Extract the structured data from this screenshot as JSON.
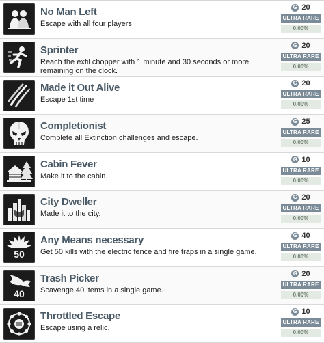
{
  "achievements": [
    {
      "title": "No Man Left",
      "description": "Escape with all four players",
      "gamerscore": "20",
      "rarity": "ULTRA RARE",
      "percent": "0.00%",
      "icon": "four-players-icon"
    },
    {
      "title": "Sprinter",
      "description": "Reach the exfil chopper with 1 minute and 30 seconds or more remaining on the clock.",
      "gamerscore": "20",
      "rarity": "ULTRA RARE",
      "percent": "0.00%",
      "icon": "running-man-icon"
    },
    {
      "title": "Made it Out Alive",
      "description": "Escape 1st time",
      "gamerscore": "20",
      "rarity": "ULTRA RARE",
      "percent": "0.00%",
      "icon": "claw-marks-icon"
    },
    {
      "title": "Completionist",
      "description": "Complete all Extinction challenges and escape.",
      "gamerscore": "25",
      "rarity": "ULTRA RARE",
      "percent": "0.00%",
      "icon": "alien-skull-icon"
    },
    {
      "title": "Cabin Fever",
      "description": "Make it to the cabin.",
      "gamerscore": "10",
      "rarity": "ULTRA RARE",
      "percent": "0.00%",
      "icon": "cabin-icon"
    },
    {
      "title": "City Dweller",
      "description": "Made it to the city.",
      "gamerscore": "20",
      "rarity": "ULTRA RARE",
      "percent": "0.00%",
      "icon": "city-skyline-icon"
    },
    {
      "title": "Any Means necessary",
      "description": "Get 50 kills with the electric fence and fire traps in a single game.",
      "gamerscore": "40",
      "rarity": "ULTRA RARE",
      "percent": "0.00%",
      "icon": "spiked-50-icon",
      "icon_text": "50"
    },
    {
      "title": "Trash Picker",
      "description": "Scavenge 40 items in a single game.",
      "gamerscore": "20",
      "rarity": "ULTRA RARE",
      "percent": "0.00%",
      "icon": "creature-40-icon",
      "icon_text": "40"
    },
    {
      "title": "Throttled Escape",
      "description": "Escape using a relic.",
      "gamerscore": "10",
      "rarity": "ULTRA RARE",
      "percent": "0.00%",
      "icon": "relic-ring-icon"
    }
  ],
  "badge_letter": "G",
  "colors": {
    "title": "#4a5a66",
    "rarity_bg": "#7b8b97",
    "percent_bg": "#e3e9e3",
    "icon_bg": "#1b1b1b"
  }
}
